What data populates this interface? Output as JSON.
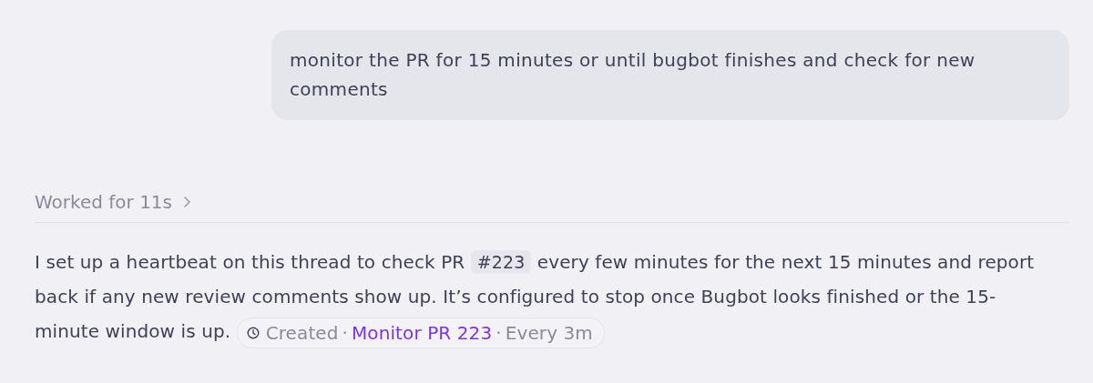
{
  "user_message": {
    "text": "monitor the PR for 15 minutes or until bugbot finishes and check for new comments"
  },
  "work_summary": {
    "label": "Worked for 11s",
    "expanded": false
  },
  "assistant_message": {
    "segments": [
      {
        "kind": "text",
        "text": "I set up a heartbeat on this thread to check PR"
      },
      {
        "kind": "code",
        "text": "#223"
      },
      {
        "kind": "text",
        "text": "every few minutes for the next 15 minutes and report back if any new review comments show up. It’s configured to stop once Bugbot looks finished or the 15-minute window is up."
      }
    ],
    "chip": [
      {
        "kind": "status",
        "text": "Created"
      },
      {
        "kind": "separator",
        "text": "·"
      },
      {
        "kind": "link",
        "text": "Monitor PR 223"
      },
      {
        "kind": "separator",
        "text": "·"
      },
      {
        "kind": "interval",
        "text": "Every 3m"
      }
    ]
  }
}
